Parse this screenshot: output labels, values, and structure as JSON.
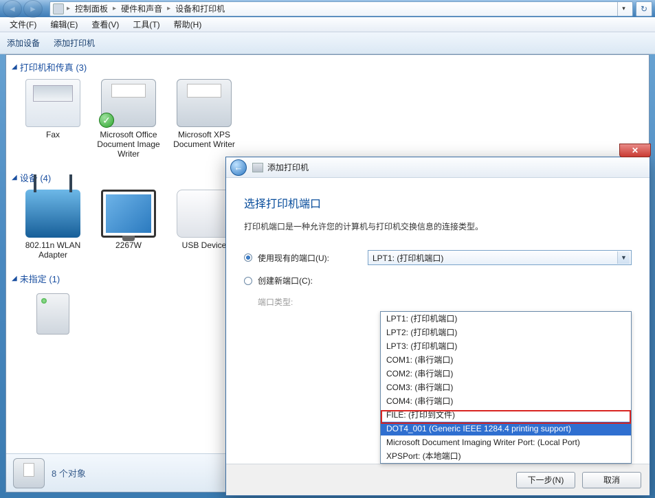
{
  "breadcrumb": {
    "part1": "控制面板",
    "part2": "硬件和声音",
    "part3": "设备和打印机"
  },
  "menu": {
    "file": "文件(F)",
    "edit": "编辑(E)",
    "view": "查看(V)",
    "tools": "工具(T)",
    "help": "帮助(H)"
  },
  "toolbar": {
    "add_device": "添加设备",
    "add_printer": "添加打印机"
  },
  "groups": {
    "printers_fax": {
      "label": "打印机和传真 (3)"
    },
    "devices": {
      "label": "设备 (4)"
    },
    "unspecified": {
      "label": "未指定 (1)"
    }
  },
  "printers": [
    {
      "name": "Fax"
    },
    {
      "name": "Microsoft Office Document Image Writer"
    },
    {
      "name": "Microsoft XPS Document Writer"
    }
  ],
  "devices": [
    {
      "name": "802.11n WLAN Adapter"
    },
    {
      "name": "2267W"
    },
    {
      "name": "USB Device"
    }
  ],
  "status": {
    "count": "8 个对象"
  },
  "dialog": {
    "title": "添加打印机",
    "heading": "选择打印机端口",
    "description": "打印机端口是一种允许您的计算机与打印机交换信息的连接类型。",
    "use_existing_port_label": "使用现有的端口(U):",
    "create_new_port_label": "创建新端口(C):",
    "port_type_label": "端口类型:",
    "selected_port": "LPT1: (打印机端口)",
    "port_options": [
      "LPT1: (打印机端口)",
      "LPT2: (打印机端口)",
      "LPT3: (打印机端口)",
      "COM1: (串行端口)",
      "COM2: (串行端口)",
      "COM3: (串行端口)",
      "COM4: (串行端口)",
      "FILE: (打印到文件)",
      "DOT4_001 (Generic IEEE 1284.4 printing support)",
      "Microsoft Document Imaging Writer Port: (Local Port)",
      "XPSPort: (本地端口)"
    ],
    "highlighted_index": 8,
    "next_button": "下一步(N)",
    "cancel_button": "取消"
  }
}
